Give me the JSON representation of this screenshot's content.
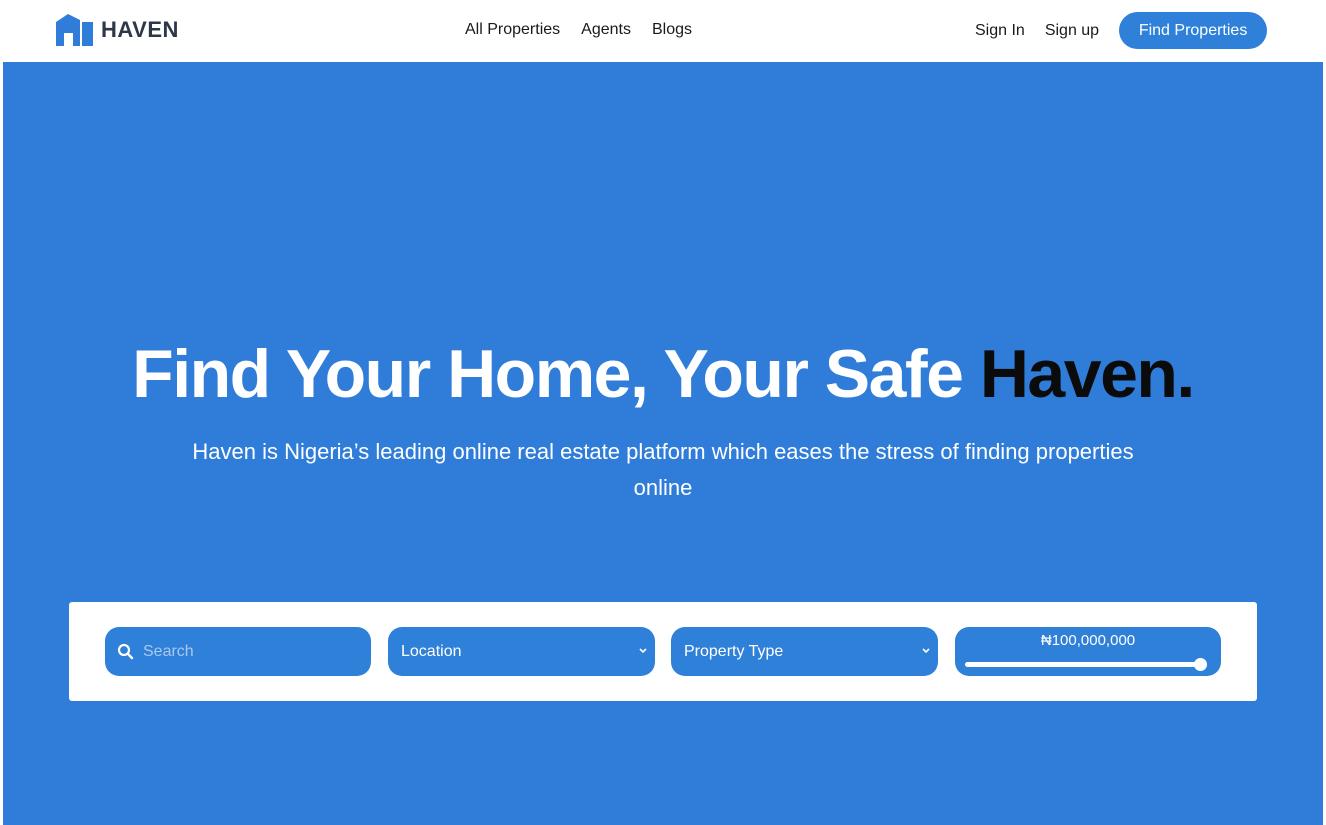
{
  "brand": {
    "name": "HAVEN"
  },
  "nav": {
    "links": [
      "All Properties",
      "Agents",
      "Blogs"
    ],
    "sign_in": "Sign In",
    "sign_up": "Sign up",
    "cta": "Find Properties"
  },
  "hero": {
    "title_main": "Find Your Home, Your Safe ",
    "title_accent": "Haven.",
    "subtitle": "Haven is Nigeria’s leading online real estate platform which eases the stress of finding properties online"
  },
  "search": {
    "search_placeholder": "Search",
    "location_label": "Location",
    "property_type_label": "Property Type",
    "price_value": "₦100,000,000",
    "price_fraction": 1.0
  },
  "colors": {
    "accent": "#2f80d9",
    "hero_bg": "#2f7dd9",
    "title_accent": "#0b0b0b"
  },
  "icons": [
    "house-logo-icon",
    "search-icon",
    "chevron-down-icon"
  ]
}
